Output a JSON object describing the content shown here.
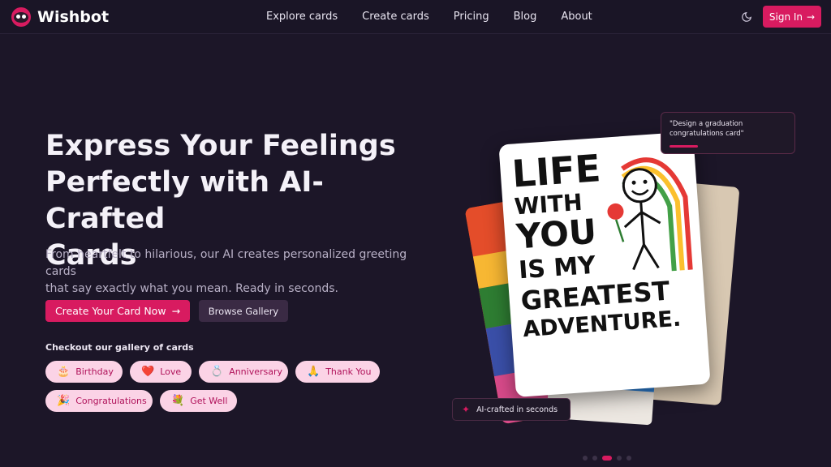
{
  "brand": {
    "name": "Wishbot",
    "accent": "#d81b60"
  },
  "nav": {
    "links": [
      "Explore cards",
      "Create cards",
      "Pricing",
      "Blog",
      "About"
    ],
    "signin_label": "Sign In",
    "theme_icon": "moon-icon"
  },
  "hero": {
    "title_line1": "Express Your Feelings",
    "title_line2": "Perfectly with AI-Crafted",
    "title_line3": "Cards",
    "subtitle_line1": "From heartfelt to hilarious, our AI creates personalized greeting cards",
    "subtitle_line2": "that say exactly what you mean. Ready in seconds.",
    "cta_primary": "Create Your Card Now",
    "cta_secondary": "Browse Gallery",
    "gallery_label": "Checkout our gallery of cards"
  },
  "chips": [
    {
      "emoji": "🎂",
      "label": "Birthday"
    },
    {
      "emoji": "❤️",
      "label": "Love"
    },
    {
      "emoji": "💍",
      "label": "Anniversary"
    },
    {
      "emoji": "🙏",
      "label": "Thank You"
    },
    {
      "emoji": "🎉",
      "label": "Congratulations"
    },
    {
      "emoji": "💐",
      "label": "Get Well"
    }
  ],
  "showcase": {
    "prompt_line1": "\"Design a graduation",
    "prompt_line2": "congratulations card\"",
    "badge": "AI-crafted in seconds",
    "card_text": [
      "LIFE",
      "WITH",
      "YOU",
      "IS MY",
      "GREATEST",
      "ADVENTURE."
    ],
    "carousel_active_index": 2,
    "carousel_count": 5
  }
}
